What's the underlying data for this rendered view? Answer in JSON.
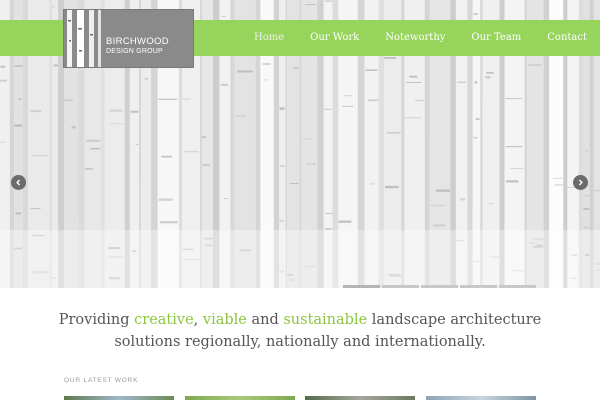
{
  "brand": {
    "line1": "BIRCHWOOD",
    "line2": "DESIGN GROUP"
  },
  "nav": {
    "items": [
      {
        "label": "Home",
        "active": true
      },
      {
        "label": "Our Work"
      },
      {
        "label": "Noteworthy"
      },
      {
        "label": "Our Team"
      },
      {
        "label": "Contact"
      }
    ]
  },
  "slider": {
    "prev_icon": "chevron-left-icon",
    "next_icon": "chevron-right-icon",
    "slide_count": 5,
    "active_index": 0
  },
  "tagline": {
    "w1": "Providing ",
    "h1": "creative",
    "w2": ", ",
    "h2": "viable",
    "w3": " and ",
    "h3": "sustainable",
    "w4": " landscape architecture",
    "line2": "solutions regionally, nationally and internationally."
  },
  "latest_work": {
    "label": "OUR LATEST WORK"
  },
  "colors": {
    "accent": "#96d45c",
    "highlight": "#8cc63f",
    "logo_bg": "#8a8a8a",
    "text": "#555555"
  }
}
